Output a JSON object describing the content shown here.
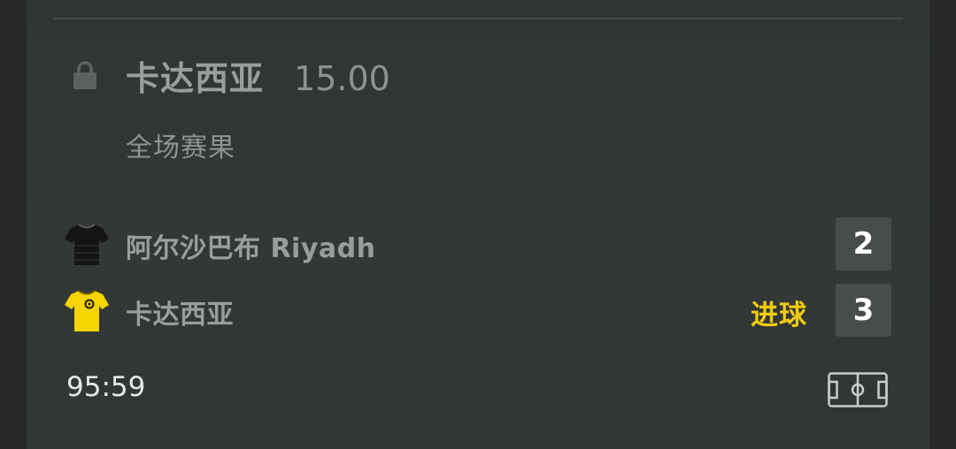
{
  "bet": {
    "selection": "卡达西亚",
    "odds": "15.00",
    "market": "全场赛果"
  },
  "match": {
    "home": {
      "name": "阿尔沙巴布 Riyadh",
      "score": "2",
      "jersey_color": "#141414"
    },
    "away": {
      "name": "卡达西亚",
      "score": "3",
      "goal_label": "进球",
      "jersey_color": "#f5d400"
    },
    "time": "95:59"
  },
  "icons": {
    "lock": "lock-icon",
    "field": "football-pitch-icon"
  },
  "colors": {
    "accent": "#f2cc12",
    "card_bg": "#323735",
    "score_bg": "#484d4b"
  }
}
